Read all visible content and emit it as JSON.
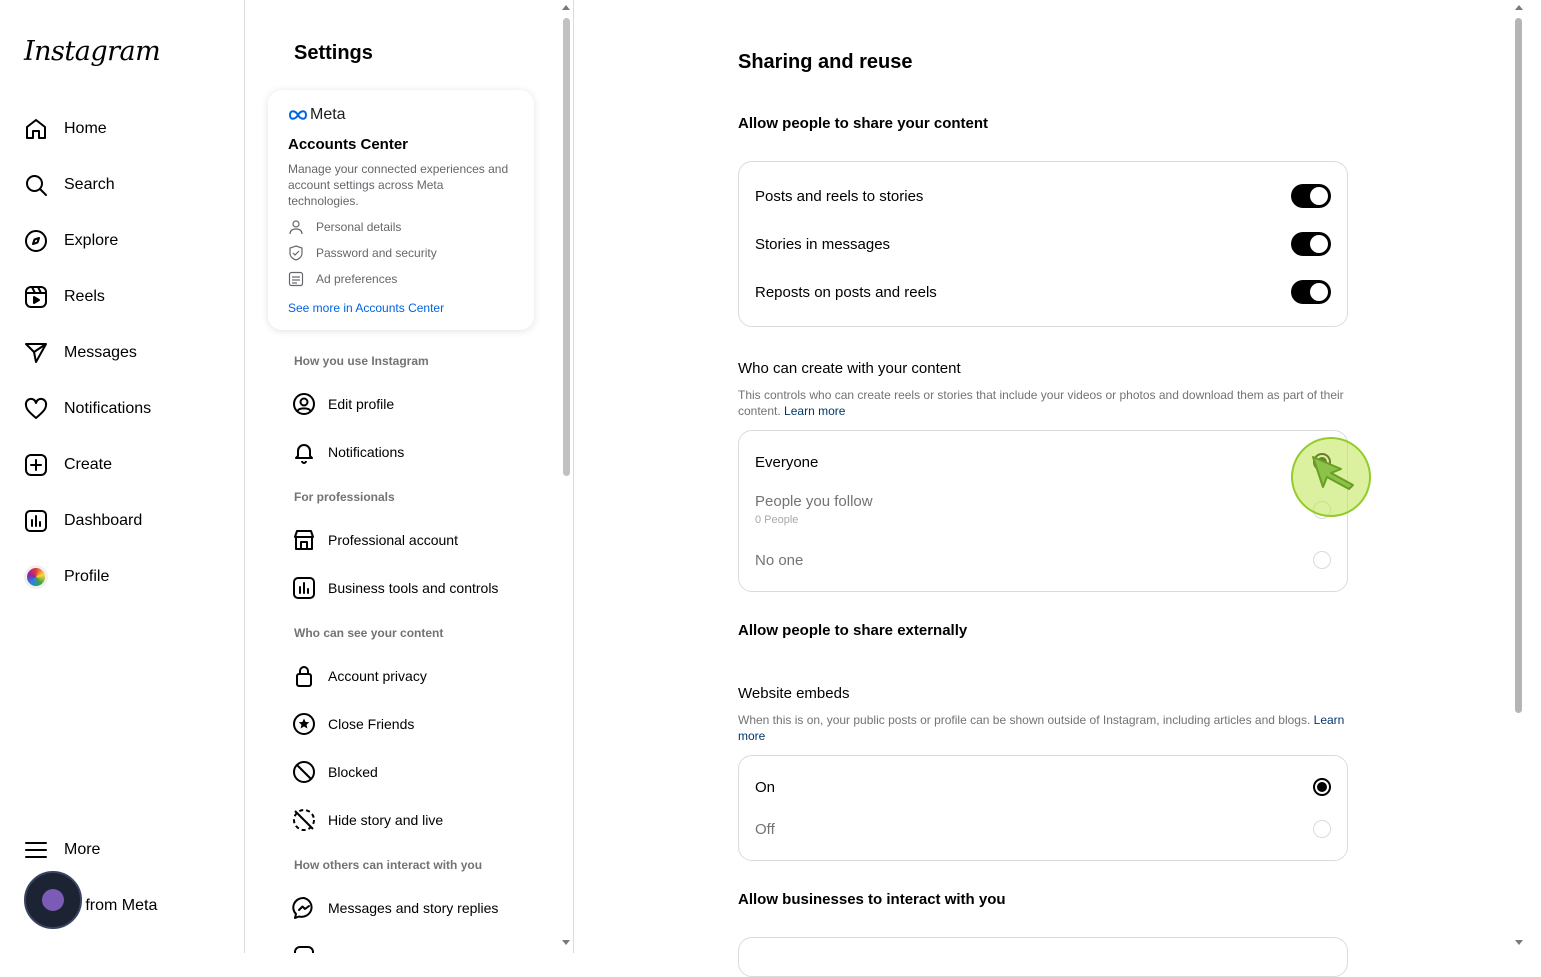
{
  "app": {
    "logo_text": "Instagram"
  },
  "nav": {
    "items": [
      {
        "label": "Home",
        "icon": "home-icon"
      },
      {
        "label": "Search",
        "icon": "search-icon"
      },
      {
        "label": "Explore",
        "icon": "compass-icon"
      },
      {
        "label": "Reels",
        "icon": "reels-icon"
      },
      {
        "label": "Messages",
        "icon": "paper-plane-icon"
      },
      {
        "label": "Notifications",
        "icon": "heart-icon"
      },
      {
        "label": "Create",
        "icon": "plus-square-icon"
      },
      {
        "label": "Dashboard",
        "icon": "bar-chart-icon"
      },
      {
        "label": "Profile",
        "icon": "avatar-icon"
      }
    ],
    "more": "More",
    "also_from_meta": "so from Meta"
  },
  "settings": {
    "title": "Settings",
    "accounts_center": {
      "brand": "Meta",
      "title": "Accounts Center",
      "description": "Manage your connected experiences and account settings across Meta technologies.",
      "rows": [
        "Personal details",
        "Password and security",
        "Ad preferences"
      ],
      "link": "See more in Accounts Center"
    },
    "sections": [
      {
        "heading": "How you use Instagram",
        "items": [
          "Edit profile",
          "Notifications"
        ]
      },
      {
        "heading": "For professionals",
        "items": [
          "Professional account",
          "Business tools and controls"
        ]
      },
      {
        "heading": "Who can see your content",
        "items": [
          "Account privacy",
          "Close Friends",
          "Blocked",
          "Hide story and live"
        ]
      },
      {
        "heading": "How others can interact with you",
        "items": [
          "Messages and story replies"
        ]
      }
    ]
  },
  "main": {
    "title": "Sharing and reuse",
    "share_heading": "Allow people to share your content",
    "share_toggles": [
      {
        "label": "Posts and reels to stories",
        "on": true
      },
      {
        "label": "Stories in messages",
        "on": true
      },
      {
        "label": "Reposts on posts and reels",
        "on": true
      }
    ],
    "create_heading": "Who can create with your content",
    "create_desc": "This controls who can create reels or stories that include your videos or photos and download them as part of their content.",
    "learn_more": "Learn more",
    "create_options": [
      {
        "label": "Everyone",
        "selected": true
      },
      {
        "label": "People you follow",
        "sub": "0 People",
        "selected": false
      },
      {
        "label": "No one",
        "selected": false
      }
    ],
    "external_heading": "Allow people to share externally",
    "embeds_heading": "Website embeds",
    "embeds_desc": "When this is on, your public posts or profile can be shown outside of Instagram, including articles and blogs.",
    "embeds_learn_more": "Learn more",
    "embeds_options": [
      {
        "label": "On",
        "selected": true
      },
      {
        "label": "Off",
        "selected": false
      }
    ],
    "business_heading": "Allow businesses to interact with you"
  }
}
